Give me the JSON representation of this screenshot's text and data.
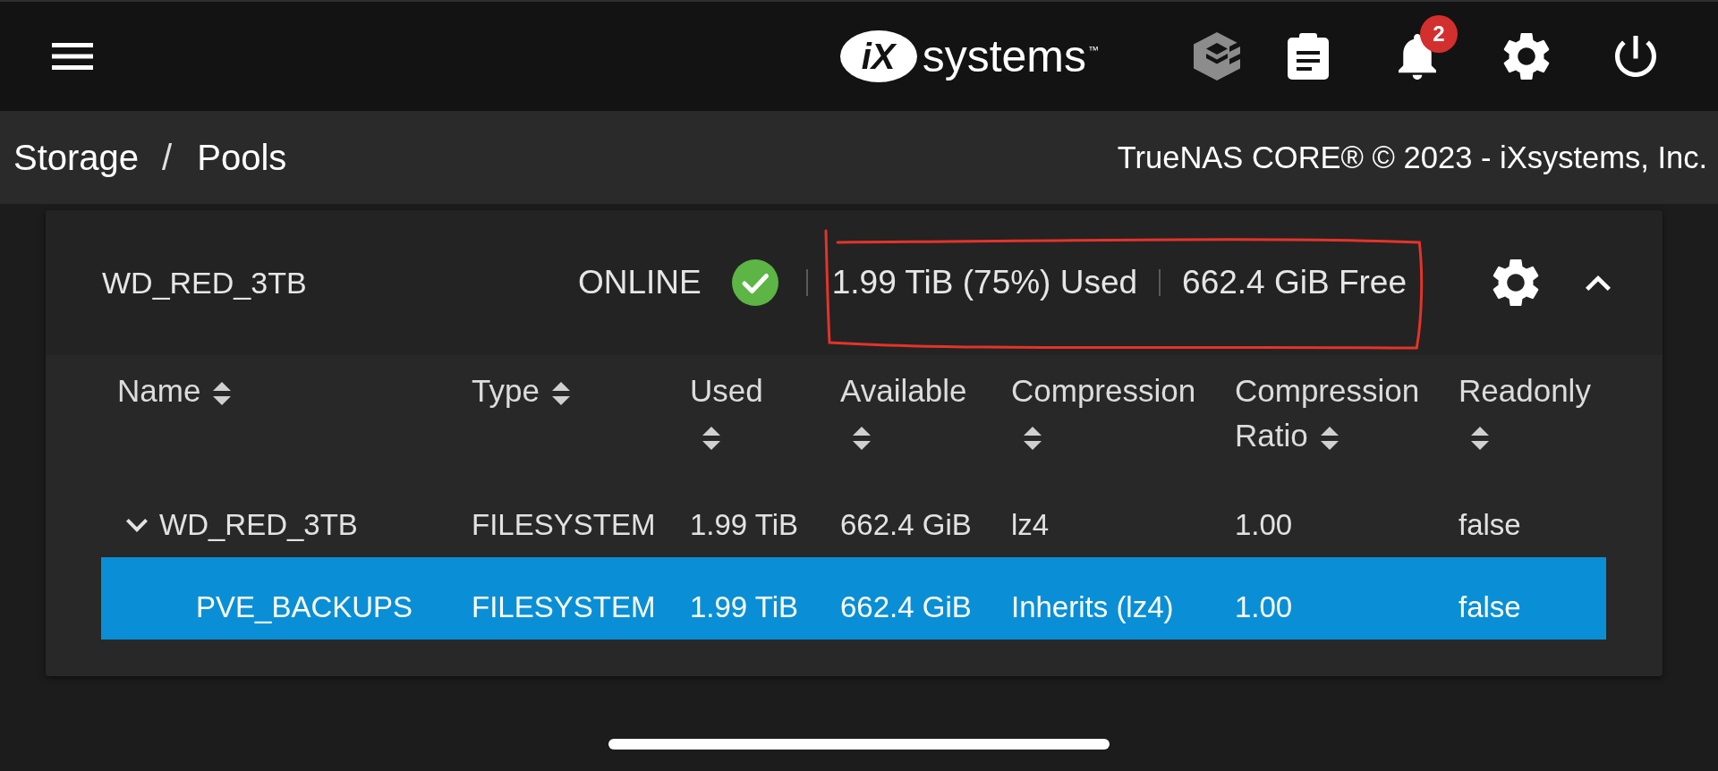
{
  "top_bar": {
    "logo": {
      "mark": "iX",
      "wordmark": "systems",
      "trademark": "™"
    },
    "notification_count": "2"
  },
  "breadcrumb": {
    "items": [
      "Storage",
      "Pools"
    ],
    "separator": "/"
  },
  "copyright": "TrueNAS CORE® © 2023 - iXsystems, Inc.",
  "pool": {
    "name": "WD_RED_3TB",
    "status": "ONLINE",
    "used": "1.99 TiB (75%) Used",
    "free": "662.4 GiB Free",
    "usage_highlighted": true,
    "expanded": true
  },
  "table": {
    "columns": [
      {
        "label": "Name",
        "sortable": true
      },
      {
        "label": "Type",
        "sortable": true
      },
      {
        "label": "Used",
        "sortable": true
      },
      {
        "label": "Available",
        "sortable": true
      },
      {
        "label": "Compression",
        "sortable": true
      },
      {
        "label": "Compression Ratio",
        "sortable": true
      },
      {
        "label": "Readonly",
        "sortable": true
      }
    ],
    "rows": [
      {
        "name": "WD_RED_3TB",
        "type": "FILESYSTEM",
        "used": "1.99 TiB",
        "available": "662.4 GiB",
        "compression": "lz4",
        "compression_ratio": "1.00",
        "readonly": "false",
        "selected": false,
        "expanded": true,
        "children": [
          {
            "name": "PVE_BACKUPS",
            "type": "FILESYSTEM",
            "used": "1.99 TiB",
            "available": "662.4 GiB",
            "compression": "Inherits (lz4)",
            "compression_ratio": "1.00",
            "readonly": "false",
            "selected": true
          }
        ]
      }
    ]
  }
}
